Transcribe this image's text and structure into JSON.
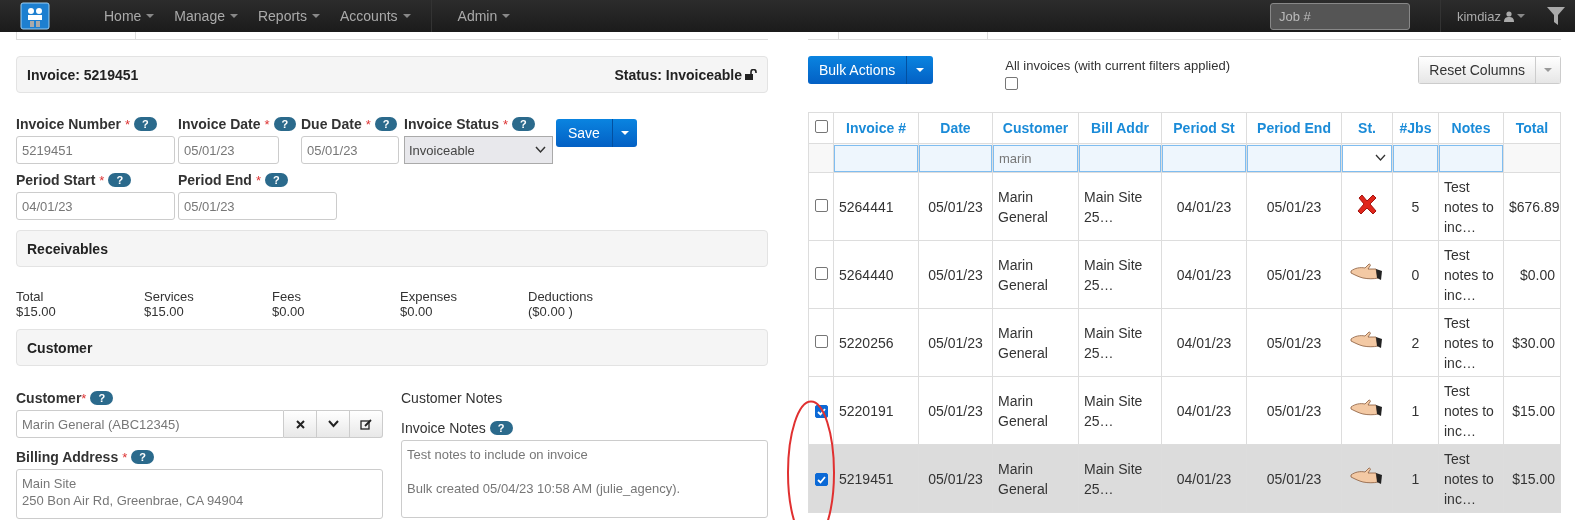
{
  "navbar": {
    "menu": [
      {
        "label": "Home"
      },
      {
        "label": "Manage"
      },
      {
        "label": "Reports"
      },
      {
        "label": "Accounts"
      }
    ],
    "admin_menu": [
      {
        "label": "Admin"
      }
    ],
    "search": {
      "placeholder": "Job #"
    },
    "user": "kimdiaz"
  },
  "invoice_panel": {
    "title": "Invoice: 5219451",
    "status": "Status: Invoiceable"
  },
  "form": {
    "row_1": [
      {
        "kind": "input",
        "label": "Invoice Number",
        "required_mark": "*",
        "help": "?",
        "value": "5219451"
      },
      {
        "kind": "input",
        "label": "Invoice Date",
        "required_mark": "*",
        "help": "?",
        "value": "05/01/23"
      },
      {
        "kind": "input",
        "label": "Due Date",
        "required_mark": "*",
        "help": "?",
        "value": "05/01/23"
      },
      {
        "kind": "select",
        "label": "Invoice Status",
        "required_mark": "*",
        "help": "?",
        "value": "Invoiceable"
      }
    ],
    "save_button": "Save",
    "row_2": [
      {
        "kind": "input",
        "label": "Period Start",
        "required_mark": "*",
        "help": "?",
        "value": "04/01/23"
      },
      {
        "kind": "input",
        "label": "Period End",
        "required_mark": "*",
        "help": "?",
        "value": "05/01/23"
      }
    ]
  },
  "receivables": {
    "title": "Receivables",
    "items": [
      {
        "label": "Total",
        "value": "$15.00"
      },
      {
        "label": "Services",
        "value": "$15.00"
      },
      {
        "label": "Fees",
        "value": "$0.00"
      },
      {
        "label": "Expenses",
        "value": "$0.00"
      },
      {
        "label": "Deductions",
        "value": "($0.00 )"
      }
    ]
  },
  "customer": {
    "title": "Customer",
    "customer_field": {
      "label": "Customer",
      "required_mark": "*",
      "help": "?",
      "value": "Marin General (ABC12345)"
    },
    "billing_address": {
      "label": "Billing Address",
      "required_mark": "*",
      "help": "?",
      "lines": [
        "Main Site",
        "250 Bon Air Rd, Greenbrae, CA 94904"
      ]
    },
    "customer_notes_label": "Customer Notes",
    "invoice_notes": {
      "label": "Invoice Notes",
      "help": "?",
      "paragraphs": [
        "Test notes to include on invoice",
        "Bulk created 05/04/23 10:58 AM (julie_agency)."
      ]
    }
  },
  "toolbar": {
    "bulk_actions": "Bulk Actions",
    "all_invoices": {
      "label": "All invoices (with current filters applied)",
      "checked": false
    },
    "reset_columns": "Reset Columns"
  },
  "table": {
    "header_checked": false,
    "columns": [
      "Invoice #",
      "Date",
      "Customer",
      "Bill Addr",
      "Period St",
      "Period End",
      "St.",
      "#Jbs",
      "Notes",
      "Total"
    ],
    "filters": {
      "customer": "marin"
    },
    "rows": [
      {
        "checked": false,
        "selected": false,
        "invoice": "5264441",
        "date": "05/01/23",
        "customer": "Marin General",
        "bill_addr": "Main Site 25…",
        "period_st": "04/01/23",
        "period_end": "05/01/23",
        "status": {
          "kind": "rejected"
        },
        "jobs": "5",
        "notes": "Test notes to inc…",
        "total": "$676.89"
      },
      {
        "checked": false,
        "selected": false,
        "invoice": "5264440",
        "date": "05/01/23",
        "customer": "Marin General",
        "bill_addr": "Main Site 25…",
        "period_st": "04/01/23",
        "period_end": "05/01/23",
        "status": {
          "kind": "handshake"
        },
        "jobs": "0",
        "notes": "Test notes to inc…",
        "total": "$0.00"
      },
      {
        "checked": false,
        "selected": false,
        "invoice": "5220256",
        "date": "05/01/23",
        "customer": "Marin General",
        "bill_addr": "Main Site 25…",
        "period_st": "04/01/23",
        "period_end": "05/01/23",
        "status": {
          "kind": "handshake"
        },
        "jobs": "2",
        "notes": "Test notes to inc…",
        "total": "$30.00"
      },
      {
        "checked": true,
        "selected": false,
        "invoice": "5220191",
        "date": "05/01/23",
        "customer": "Marin General",
        "bill_addr": "Main Site 25…",
        "period_st": "04/01/23",
        "period_end": "05/01/23",
        "status": {
          "kind": "handshake"
        },
        "jobs": "1",
        "notes": "Test notes to inc…",
        "total": "$15.00"
      },
      {
        "checked": true,
        "selected": true,
        "invoice": "5219451",
        "date": "05/01/23",
        "customer": "Marin General",
        "bill_addr": "Main Site 25…",
        "period_st": "04/01/23",
        "period_end": "05/01/23",
        "status": {
          "kind": "handshake"
        },
        "jobs": "1",
        "notes": "Test notes to inc…",
        "total": "$15.00"
      }
    ]
  }
}
